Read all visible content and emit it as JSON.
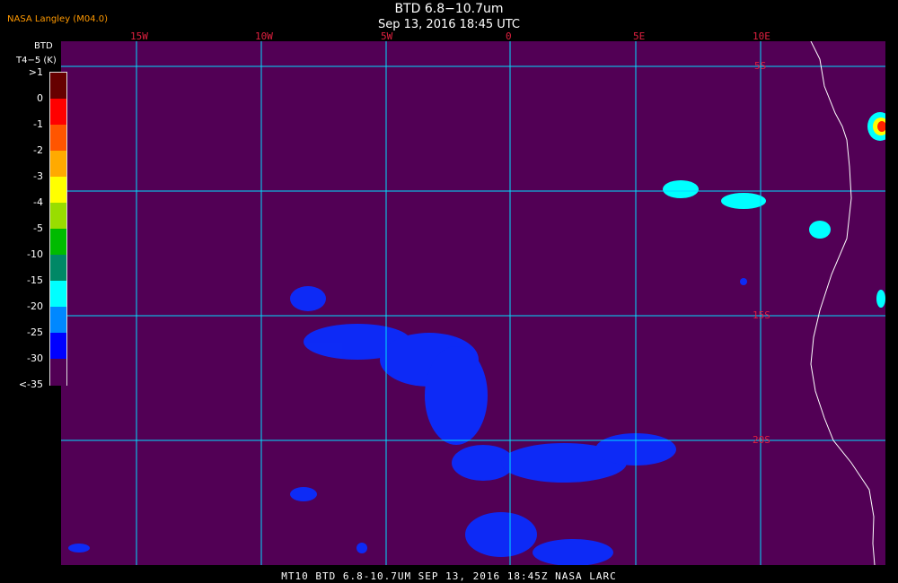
{
  "header": {
    "title": "BTD 6.8−10.7um",
    "subtitle": "Sep 13, 2016 18:45 UTC",
    "provider": "NASA Langley (M04.0)"
  },
  "legend": {
    "title": "BTD",
    "unit": "T4−5 (K)",
    "ticks": [
      ">1",
      "0",
      "-1",
      "-2",
      "-3",
      "-4",
      "-5",
      "-10",
      "-15",
      "-20",
      "-25",
      "-30",
      "<-35"
    ],
    "colors": [
      "#660000",
      "#ff0000",
      "#ff5500",
      "#ffaa00",
      "#ffff00",
      "#99dd00",
      "#00bb00",
      "#008866",
      "#00ffff",
      "#0088ff",
      "#0000ff",
      "#520055"
    ]
  },
  "grid": {
    "lon_labels": [
      "15W",
      "10W",
      "5W",
      "0",
      "5E",
      "10E"
    ],
    "lat_labels": [
      "5S",
      "15S",
      "20S"
    ]
  },
  "colors": {
    "background": "#520055",
    "grid": "#00ddff",
    "labels": "#e02040",
    "low_cloud": "#0a2dff",
    "high_cloud": "#00ffff"
  },
  "footer": {
    "text": "MT10   BTD 6.8-10.7UM   SEP 13, 2016 18:45Z   NASA LARC"
  }
}
